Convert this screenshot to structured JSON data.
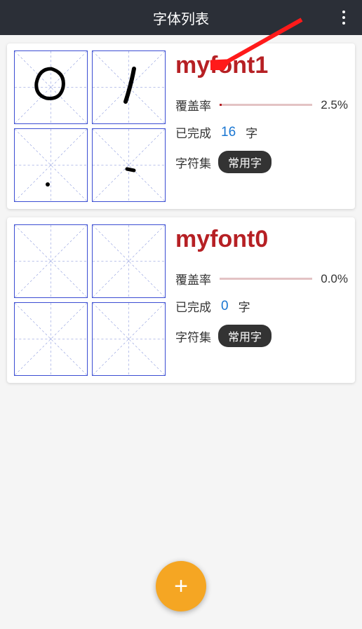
{
  "header": {
    "title": "字体列表"
  },
  "labels": {
    "coverage": "覆盖率",
    "completed": "已完成",
    "char_unit": "字",
    "charset": "字符集"
  },
  "fonts": [
    {
      "name": "myfont1",
      "coverage_pct": "2.5%",
      "coverage_fill": 2.5,
      "completed_count": "16",
      "charset_badge": "常用字",
      "glyphs": [
        "circle",
        "stroke1",
        "dot-low",
        "dot-mid"
      ]
    },
    {
      "name": "myfont0",
      "coverage_pct": "0.0%",
      "coverage_fill": 0,
      "completed_count": "0",
      "charset_badge": "常用字",
      "glyphs": [
        "empty",
        "empty",
        "empty",
        "empty"
      ]
    }
  ],
  "colors": {
    "accent": "#b62024",
    "link": "#1976d2",
    "fab": "#f5a623",
    "header_bg": "#2b2f37",
    "cell_border": "#3b4dd3"
  }
}
